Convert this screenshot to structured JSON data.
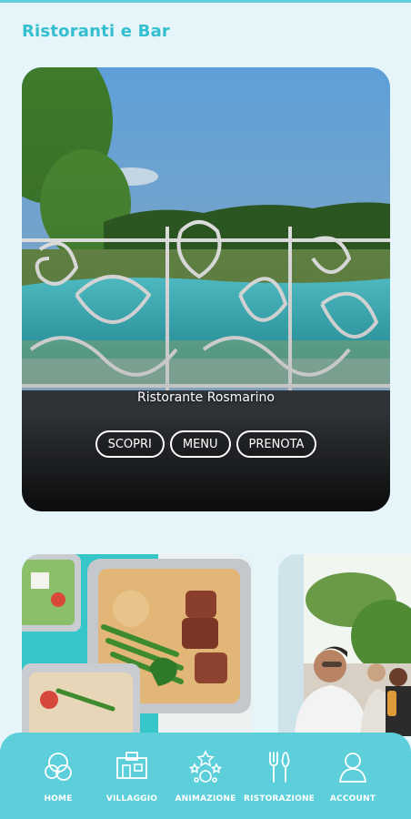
{
  "page": {
    "title": "Ristoranti e Bar"
  },
  "hero": {
    "name": "Ristorante Rosmarino",
    "buttons": {
      "discover": "SCOPRI",
      "menu": "MENU",
      "book": "PRENOTA"
    }
  },
  "nav": {
    "items": [
      {
        "label": "HOME",
        "icon": "home-icon"
      },
      {
        "label": "VILLAGGIO",
        "icon": "village-icon"
      },
      {
        "label": "ANIMAZIONE",
        "icon": "entertainment-icon"
      },
      {
        "label": "RISTORAZIONE",
        "icon": "dining-icon"
      },
      {
        "label": "ACCOUNT",
        "icon": "account-icon"
      }
    ]
  },
  "colors": {
    "accent": "#33bfcf",
    "nav_bg": "#5ccfdb",
    "background": "#e6f5f9"
  }
}
